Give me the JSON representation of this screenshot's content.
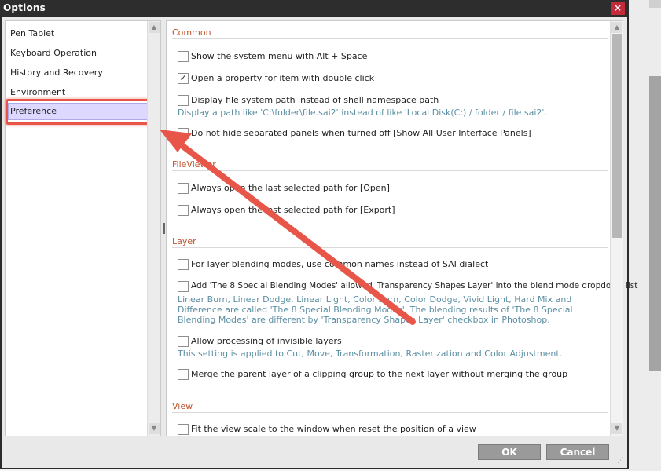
{
  "window": {
    "title": "Options",
    "close_glyph": "×"
  },
  "sidebar": {
    "items": [
      {
        "label": "Pen Tablet"
      },
      {
        "label": "Keyboard Operation"
      },
      {
        "label": "History and Recovery"
      },
      {
        "label": "Environment"
      },
      {
        "label": "Preference"
      }
    ],
    "selected": "Preference"
  },
  "sections": {
    "common": {
      "title": "Common",
      "items": [
        {
          "label": "Show the system menu with Alt + Space",
          "checked": false
        },
        {
          "label": "Open a property for item with double click",
          "checked": true
        },
        {
          "label": "Display file system path instead of shell namespace path",
          "checked": false,
          "desc": "Display a path like 'C:\\folder\\file.sai2' instead of like 'Local Disk(C:) / folder / file.sai2'."
        },
        {
          "label": "Do not hide separated panels when turned off [Show All User Interface Panels]",
          "checked": false
        }
      ]
    },
    "fileviewer": {
      "title": "FileViewer",
      "items": [
        {
          "label": "Always open the last selected path for [Open]",
          "checked": false
        },
        {
          "label": "Always open the last selected path for [Export]",
          "checked": false
        }
      ]
    },
    "layer": {
      "title": "Layer",
      "items": [
        {
          "label": "For layer blending modes, use common names instead of SAI dialect",
          "checked": false
        },
        {
          "label": "Add 'The 8 Special Blending Modes' allowed 'Transparency Shapes Layer' into the blend mode dropdown list",
          "checked": false,
          "desc": "Linear Burn, Linear Dodge, Linear Light, Color Burn, Color Dodge, Vivid Light, Hard Mix and Difference are called 'The 8 Special Blending Modes'. The blending results of 'The 8 Special Blending Modes' are different by 'Transparency Shapes Layer' checkbox in Photoshop."
        },
        {
          "label": "Allow processing of invisible layers",
          "checked": false,
          "desc": "This setting is applied to Cut, Move, Transformation, Rasterization and Color Adjustment."
        },
        {
          "label": "Merge the parent layer of a clipping group to the next layer without merging the group",
          "checked": false
        }
      ]
    },
    "view": {
      "title": "View",
      "items": [
        {
          "label": "Fit the view scale to the window when reset the position of a view",
          "checked": false
        }
      ]
    }
  },
  "buttons": {
    "ok": "OK",
    "cancel": "Cancel"
  },
  "colors": {
    "annotation_arrow": "#e8564a",
    "section_title": "#c0532c",
    "description": "#5b8fa3",
    "selection": "#dcd8ff"
  }
}
